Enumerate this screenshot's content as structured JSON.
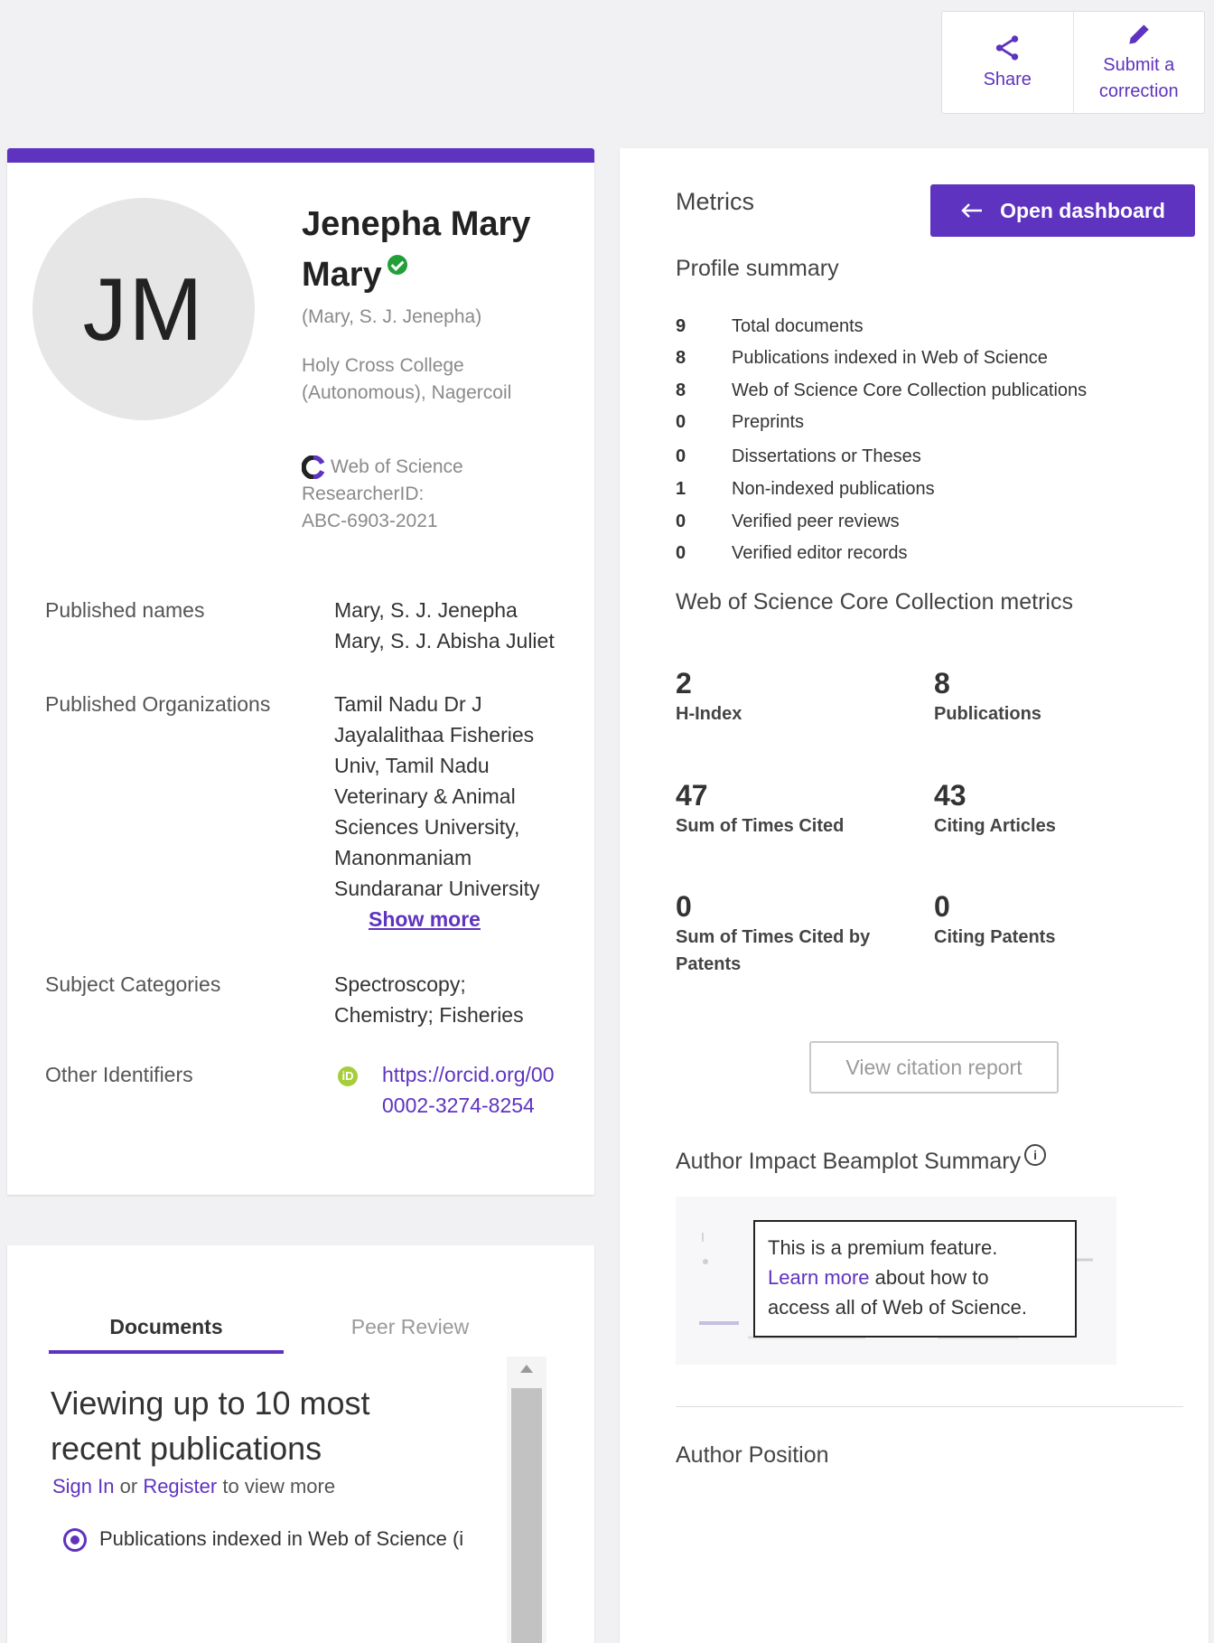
{
  "actions": {
    "share": "Share",
    "submit_line1": "Submit a",
    "submit_line2": "correction"
  },
  "profile": {
    "initials": "JM",
    "name_line1": "Jenepha Mary",
    "name_line2": "Mary",
    "alt_name": "(Mary, S. J. Jenepha)",
    "affil_line1": "Holy Cross College",
    "affil_line2": "(Autonomous), Nagercoil",
    "wos_label": "Web of Science",
    "rid_label": "ResearcherID:",
    "rid_value": "ABC-6903-2021"
  },
  "fields": {
    "published_names_label": "Published names",
    "published_names": [
      "Mary, S. J. Jenepha",
      "Mary, S. J. Abisha Juliet"
    ],
    "orgs_label": "Published Organizations",
    "orgs": [
      "Tamil Nadu Dr J",
      "Jayalalithaa Fisheries",
      "Univ,  Tamil Nadu",
      "Veterinary & Animal",
      "Sciences University,",
      "Manonmaniam",
      "Sundaranar University"
    ],
    "show_more": "Show more",
    "subjects_label": "Subject Categories",
    "subjects": [
      "Spectroscopy;",
      "Chemistry;  Fisheries"
    ],
    "other_ids_label": "Other Identifiers",
    "orcid_line1": "https://orcid.org/00",
    "orcid_line2": "0002-3274-8254"
  },
  "docs": {
    "tab_documents": "Documents",
    "tab_peer_review": "Peer Review",
    "title": "Viewing up to 10 most recent publications",
    "sign_in": "Sign In",
    "or": "or",
    "register": "Register",
    "to_view_more": "to view more",
    "radio_label": "Publications indexed in Web of Science (i"
  },
  "metrics": {
    "heading": "Metrics",
    "open_dashboard": "Open dashboard",
    "profile_summary": "Profile summary",
    "summary": [
      {
        "n": "9",
        "label": "Total documents"
      },
      {
        "n": "8",
        "label": "Publications indexed in Web of Science"
      },
      {
        "n": "8",
        "label": "Web of Science Core Collection publications"
      },
      {
        "n": "0",
        "label": "Preprints"
      },
      {
        "n": "0",
        "label": "Dissertations or Theses"
      },
      {
        "n": "1",
        "label": "Non-indexed publications"
      },
      {
        "n": "0",
        "label": "Verified peer reviews"
      },
      {
        "n": "0",
        "label": "Verified editor records"
      }
    ],
    "core_heading": "Web of Science Core Collection metrics",
    "core": [
      {
        "value": "2",
        "label": "H-Index"
      },
      {
        "value": "8",
        "label": "Publications"
      },
      {
        "value": "47",
        "label": "Sum of Times Cited"
      },
      {
        "value": "43",
        "label": "Citing Articles"
      },
      {
        "value": "0",
        "label": "Sum of Times Cited by Patents"
      },
      {
        "value": "0",
        "label": "Citing Patents"
      }
    ],
    "view_report": "View citation report",
    "beamplot_heading": "Author Impact Beamplot Summary",
    "premium_line1": "This is a premium feature.",
    "premium_link": "Learn more",
    "premium_line2_rest": "about how to",
    "premium_line3": "access all of Web of Science.",
    "author_position": "Author Position"
  }
}
